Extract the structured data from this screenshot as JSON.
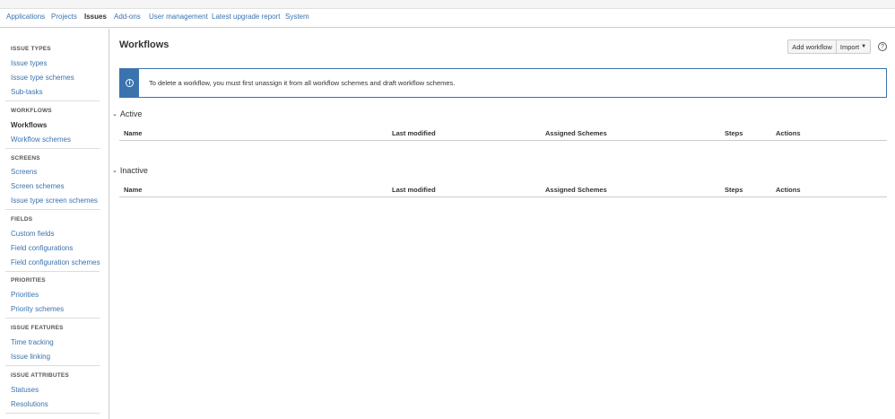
{
  "admin_nav": {
    "tabs": [
      {
        "label": "Applications",
        "active": false
      },
      {
        "label": "Projects",
        "active": false
      },
      {
        "label": "Issues",
        "active": true
      },
      {
        "label": "Add-ons",
        "active": false
      },
      {
        "label": "User management",
        "active": false
      },
      {
        "label": "Latest upgrade report",
        "active": false
      },
      {
        "label": "System",
        "active": false
      }
    ]
  },
  "sidebar": {
    "sections": [
      {
        "heading": "ISSUE TYPES",
        "items": [
          "Issue types",
          "Issue type schemes",
          "Sub-tasks"
        ]
      },
      {
        "heading": "WORKFLOWS",
        "items": [
          "Workflows",
          "Workflow schemes"
        ]
      },
      {
        "heading": "SCREENS",
        "items": [
          "Screens",
          "Screen schemes",
          "Issue type screen schemes"
        ]
      },
      {
        "heading": "FIELDS",
        "items": [
          "Custom fields",
          "Field configurations",
          "Field configuration schemes"
        ]
      },
      {
        "heading": "PRIORITIES",
        "items": [
          "Priorities",
          "Priority schemes"
        ]
      },
      {
        "heading": "ISSUE FEATURES",
        "items": [
          "Time tracking",
          "Issue linking"
        ]
      },
      {
        "heading": "ISSUE ATTRIBUTES",
        "items": [
          "Statuses",
          "Resolutions"
        ]
      }
    ],
    "active_item": "Workflows"
  },
  "page": {
    "title": "Workflows",
    "add_button": "Add workflow",
    "import_button": "Import",
    "help_icon": "question-circle-icon",
    "help_glyph": "?",
    "info_icon_glyph": "i",
    "info_message": "To delete a workflow, you must first unassign it from all workflow schemes and draft workflow schemes.",
    "accent_color": "#3b73af"
  },
  "tables": {
    "active": {
      "title": "Active",
      "columns": [
        "Name",
        "Last modified",
        "Assigned Schemes",
        "Steps",
        "Actions"
      ]
    },
    "inactive": {
      "title": "Inactive",
      "columns": [
        "Name",
        "Last modified",
        "Assigned Schemes",
        "Steps",
        "Actions"
      ]
    }
  }
}
